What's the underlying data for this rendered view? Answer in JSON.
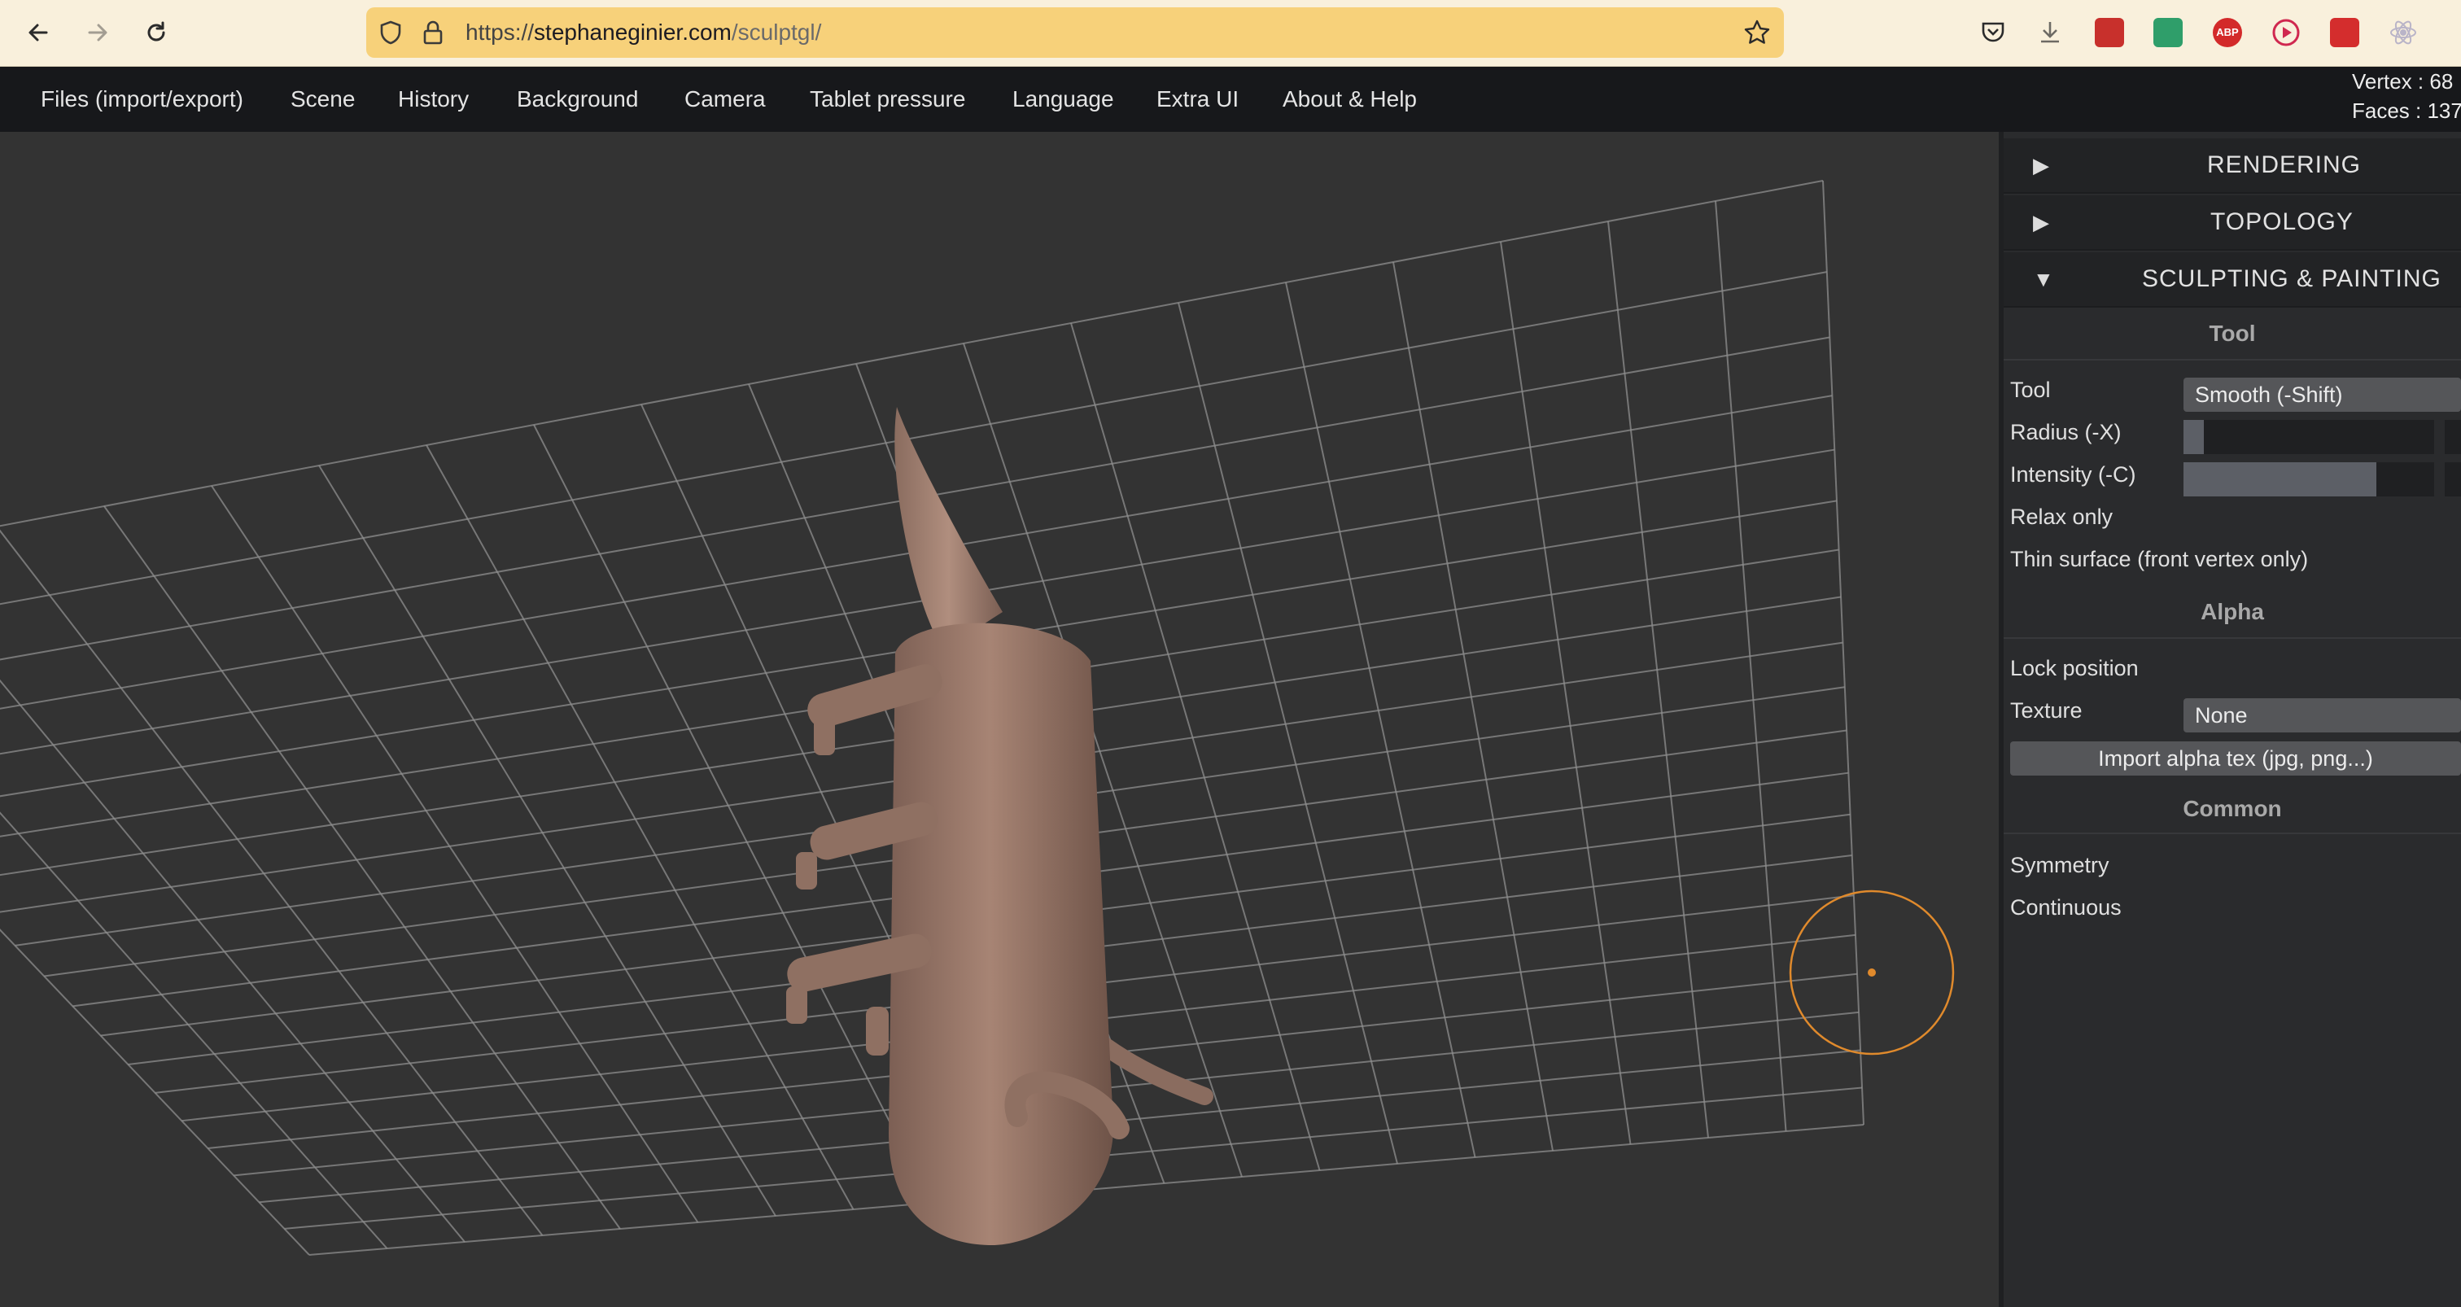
{
  "browser": {
    "url_prefix": "https://",
    "url_host": "stephaneginier.com",
    "url_path": "/sculptgl/",
    "icons": [
      "back-icon",
      "forward-icon",
      "reload-icon",
      "shield-icon",
      "lock-icon",
      "star-icon",
      "pocket-icon",
      "download-icon",
      "extension-icon",
      "extension-icon",
      "adblock-icon",
      "extension-icon",
      "extension-icon",
      "extension-icon"
    ]
  },
  "menu": {
    "items": [
      "Files (import/export)",
      "Scene",
      "History",
      "Background",
      "Camera",
      "Tablet pressure",
      "Language",
      "Extra UI",
      "About & Help"
    ]
  },
  "stats": {
    "vertex": "Vertex : 68",
    "faces": "Faces : 137"
  },
  "panel": {
    "sections": [
      {
        "arrow": "▶",
        "title": "RENDERING",
        "expanded": false
      },
      {
        "arrow": "▶",
        "title": "TOPOLOGY",
        "expanded": false
      },
      {
        "arrow": "▼",
        "title": "SCULPTING & PAINTING",
        "expanded": true
      }
    ],
    "tool_group": {
      "heading": "Tool",
      "tool_label": "Tool",
      "tool_value": "Smooth (-Shift)",
      "radius_label": "Radius (-X)",
      "radius_fraction": 0.08,
      "intensity_label": "Intensity (-C)",
      "intensity_fraction": 0.77,
      "relax_label": "Relax only",
      "thin_label": "Thin surface (front vertex only)"
    },
    "alpha_group": {
      "heading": "Alpha",
      "lock_label": "Lock position",
      "texture_label": "Texture",
      "texture_value": "None",
      "import_button": "Import alpha tex (jpg, png...)"
    },
    "common_group": {
      "heading": "Common",
      "symmetry_label": "Symmetry",
      "continuous_label": "Continuous"
    }
  },
  "colors": {
    "chrome": "#f9f0dc",
    "url_bar": "#f7d17a",
    "menubar": "#17181b",
    "viewport": "#333333",
    "grid": "#8e8e8e",
    "mesh": "#9c7b6c",
    "brush": "#e08a2c"
  }
}
